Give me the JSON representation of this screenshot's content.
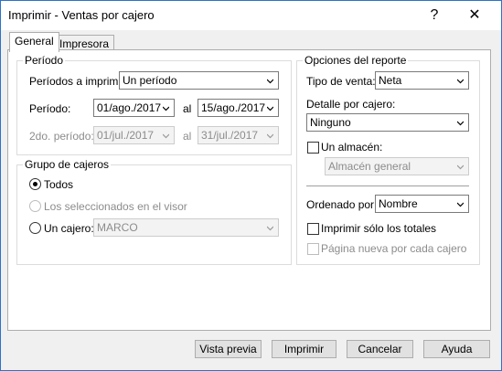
{
  "window": {
    "title": "Imprimir - Ventas por cajero",
    "help": "?",
    "close": "✕"
  },
  "tabs": [
    {
      "label": "General",
      "active": true
    },
    {
      "label": "Impresora",
      "active": false
    }
  ],
  "periodo": {
    "group_title": "Período",
    "periodos_label": "Períodos a imprimir:",
    "periodos_value": "Un período",
    "periodo_label": "Período:",
    "periodo_from": "01/ago./2017",
    "periodo_al": "al",
    "periodo_to": "15/ago./2017",
    "segundo_label": "2do. período:",
    "segundo_from": "01/jul./2017",
    "segundo_al": "al",
    "segundo_to": "31/jul./2017"
  },
  "grupo": {
    "group_title": "Grupo de cajeros",
    "todos": "Todos",
    "seleccionados": "Los seleccionados en el visor",
    "un_cajero": "Un cajero:",
    "cajero_value": "MARCO"
  },
  "opciones": {
    "group_title": "Opciones del reporte",
    "tipo_label": "Tipo de venta:",
    "tipo_value": "Neta",
    "detalle_label": "Detalle por cajero:",
    "detalle_value": "Ninguno",
    "almacen_label": "Un almacén:",
    "almacen_value": "Almacén general",
    "ordenado_label": "Ordenado por:",
    "ordenado_value": "Nombre",
    "totales_label": "Imprimir sólo los totales",
    "pagina_label": "Página nueva por cada cajero"
  },
  "buttons": {
    "vista_previa": "Vista previa",
    "imprimir": "Imprimir",
    "cancelar": "Cancelar",
    "ayuda": "Ayuda"
  },
  "colors": {
    "window_border": "#2d72c8",
    "dialog_bg": "#f0f0f0"
  }
}
